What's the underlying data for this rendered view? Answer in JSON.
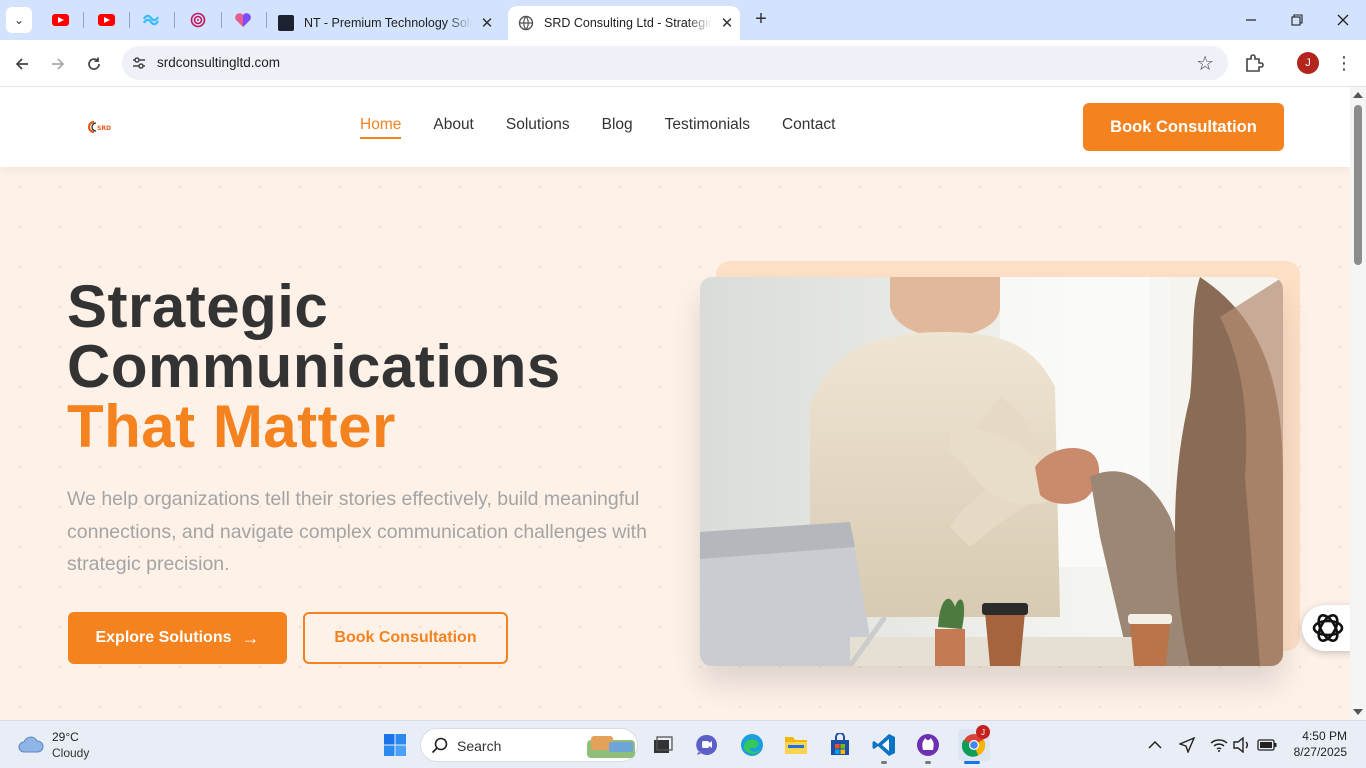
{
  "browser": {
    "tabs": [
      {
        "title": "NT - Premium Technology Solutions",
        "active": false
      },
      {
        "title": "SRD Consulting Ltd - Strategic Communications",
        "active": true
      }
    ],
    "pinned_tabs": [
      "youtube-icon",
      "youtube-icon",
      "tailwind-icon",
      "spiral-icon",
      "heart-app-icon"
    ],
    "url": "srdconsultingltd.com",
    "profile_initial": "J",
    "new_tab_glyph": "+",
    "close_glyph": "✕"
  },
  "site": {
    "logo_text": "SRD",
    "nav": {
      "items": [
        "Home",
        "About",
        "Solutions",
        "Blog",
        "Testimonials",
        "Contact"
      ],
      "active": "Home",
      "cta": "Book Consultation"
    },
    "hero": {
      "title_line1": "Strategic",
      "title_line2": "Communications",
      "title_accent": "That Matter",
      "subtitle": "We help organizations tell their stories effectively, build meaningful connections, and navigate complex communication challenges with strategic precision.",
      "primary_button": "Explore Solutions",
      "primary_arrow": "→",
      "secondary_button": "Book Consultation"
    },
    "colors": {
      "accent": "#f4831f",
      "background": "#fdf1e8",
      "heading": "#333333",
      "subtitle": "#a4a4a4"
    }
  },
  "taskbar": {
    "weather": {
      "temp": "29°C",
      "condition": "Cloudy"
    },
    "search_placeholder": "Search",
    "apps": [
      "windows-start-icon",
      "search-icon",
      "task-view-icon",
      "chat-icon",
      "edge-icon",
      "file-explorer-icon",
      "store-icon",
      "vscode-icon",
      "github-icon",
      "chrome-icon"
    ],
    "chrome_badge": "J",
    "clock": {
      "time": "4:50 PM",
      "date": "8/27/2025"
    }
  }
}
